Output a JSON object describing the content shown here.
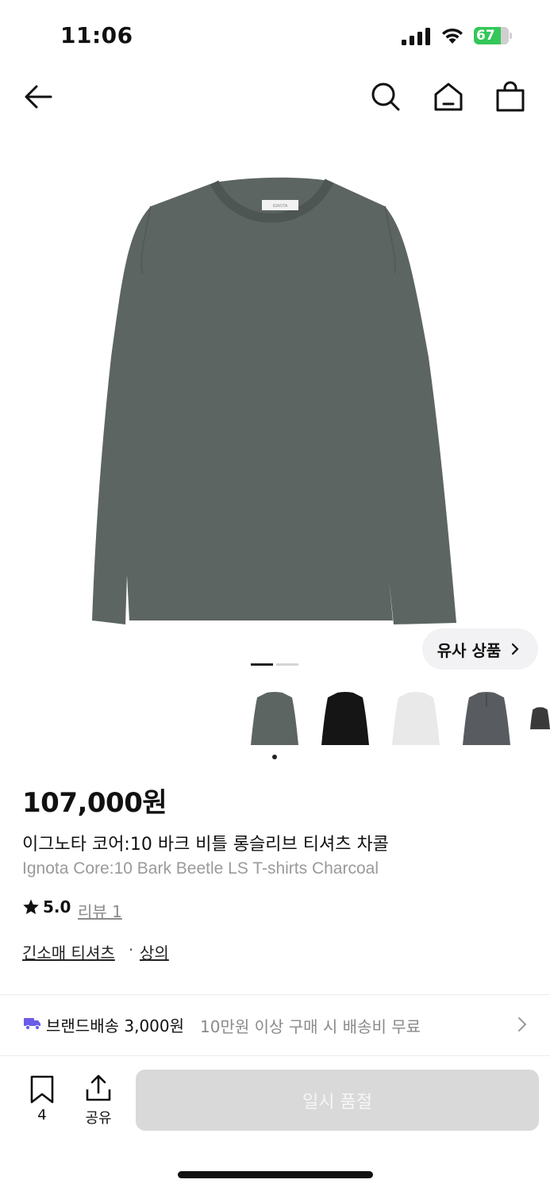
{
  "status_bar": {
    "time": "11:06",
    "battery": "67"
  },
  "product": {
    "price": "107,000원",
    "name_ko": "이그노타 코어:10 바크 비틀 롱슬리브 티셔츠 차콜",
    "name_en": "Ignota Core:10 Bark Beetle LS T-shirts Charcoal",
    "rating": "5.0",
    "review_label": "리뷰 1",
    "categories": [
      "긴소매 티셔츠",
      "상의"
    ],
    "category_separator": "·",
    "main_image_color": "#5d6563",
    "thumbnail_colors": [
      "#5d6563",
      "#151515",
      "#e9e9e9",
      "#585c61",
      "#3a3a3a"
    ]
  },
  "similar_button": {
    "label": "유사 상품"
  },
  "shipping": {
    "label": "브랜드배송 3,000원",
    "note": "10만원 이상 구매 시 배송비 무료"
  },
  "bottom_bar": {
    "bookmark_count": "4",
    "share_label": "공유",
    "buy_button_label": "일시 품절"
  },
  "colors": {
    "accent_icon": "#6b5ce7",
    "soldout_bg": "#d9d9d9"
  }
}
